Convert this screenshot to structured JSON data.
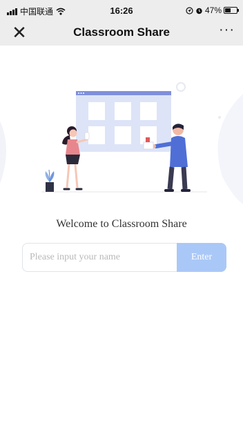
{
  "status_bar": {
    "carrier": "中国联通",
    "time": "16:26",
    "battery": "47%",
    "battery_level": 0.47,
    "icons": [
      "signal-icon",
      "wifi-icon",
      "location-icon",
      "alarm-icon",
      "battery-icon"
    ]
  },
  "nav": {
    "title": "Classroom Share",
    "close_icon": "close-icon",
    "more_icon": "more-icon",
    "close_symbol": "✕",
    "more_symbol": "···"
  },
  "main": {
    "welcome_text": "Welcome to Classroom Share",
    "name_input": {
      "placeholder": "Please input your name",
      "value": ""
    },
    "enter_button": "Enter",
    "illustration": "classroom-share-illustration"
  },
  "colors": {
    "bar_background": "#ededed",
    "accent": "#aac8f7",
    "board": "#dde4f8",
    "board_header": "#7f8fdc",
    "person_woman": "#e8868d",
    "person_man": "#4f6fd6"
  }
}
